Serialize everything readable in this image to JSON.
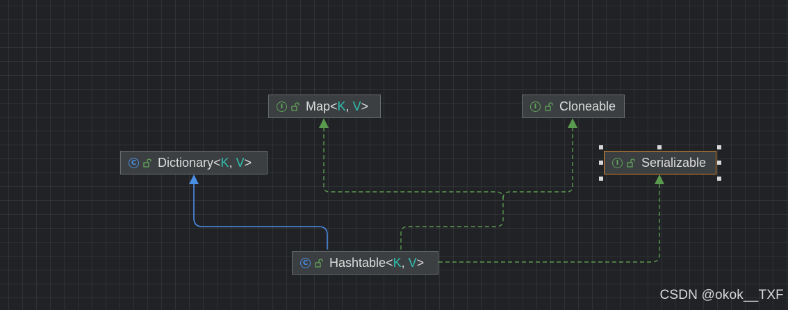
{
  "nodes": {
    "map": {
      "kind": "I",
      "prefix": "Map<",
      "p1": "K",
      "sep": ", ",
      "p2": "V",
      "suffix": ">"
    },
    "cloneable": {
      "kind": "I",
      "name": "Cloneable"
    },
    "dictionary": {
      "kind": "C",
      "prefix": "Dictionary<",
      "p1": "K",
      "sep": ", ",
      "p2": "V",
      "suffix": ">"
    },
    "serializable": {
      "kind": "I",
      "name": "Serializable"
    },
    "hashtable": {
      "kind": "C",
      "prefix": "Hashtable<",
      "p1": "K",
      "sep": ", ",
      "p2": "V",
      "suffix": ">"
    }
  },
  "colors": {
    "background": "#212226",
    "node_fill": "#3c3f41",
    "node_border": "#6b6f72",
    "selected_border": "#d5862b",
    "extends_edge": "#4a8ee6",
    "implements_edge": "#5a9a4f",
    "type_param": "#2fbfb0"
  },
  "edges": [
    {
      "from": "Hashtable",
      "to": "Dictionary",
      "relation": "extends"
    },
    {
      "from": "Hashtable",
      "to": "Map",
      "relation": "implements"
    },
    {
      "from": "Hashtable",
      "to": "Cloneable",
      "relation": "implements"
    },
    {
      "from": "Hashtable",
      "to": "Serializable",
      "relation": "implements"
    }
  ],
  "selected_node": "Serializable",
  "watermark": "CSDN @okok__TXF"
}
